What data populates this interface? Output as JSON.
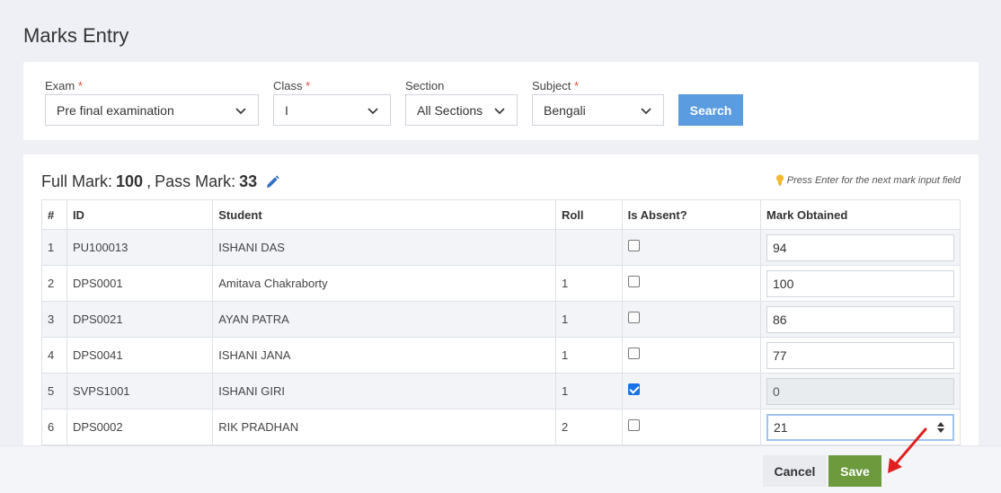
{
  "page": {
    "title": "Marks Entry"
  },
  "filters": {
    "exam": {
      "label": "Exam",
      "value": "Pre final examination"
    },
    "class": {
      "label": "Class",
      "value": "I"
    },
    "section": {
      "label": "Section",
      "value": "All Sections"
    },
    "subject": {
      "label": "Subject",
      "value": "Bengali"
    },
    "required_marker": "*",
    "search_label": "Search"
  },
  "marks": {
    "full_label": "Full Mark:",
    "full_value": "100",
    "pass_label": "Pass Mark:",
    "pass_value": "33",
    "hint": "Press Enter for the next mark input field"
  },
  "table": {
    "headers": [
      "#",
      "ID",
      "Student",
      "Roll",
      "Is Absent?",
      "Mark Obtained"
    ],
    "rows": [
      {
        "num": "1",
        "id": "PU100013",
        "student": "ISHANI DAS",
        "roll": "",
        "absent": false,
        "mark": "94"
      },
      {
        "num": "2",
        "id": "DPS0001",
        "student": "Amitava Chakraborty",
        "roll": "1",
        "absent": false,
        "mark": "100"
      },
      {
        "num": "3",
        "id": "DPS0021",
        "student": "AYAN PATRA",
        "roll": "1",
        "absent": false,
        "mark": "86"
      },
      {
        "num": "4",
        "id": "DPS0041",
        "student": "ISHANI JANA",
        "roll": "1",
        "absent": false,
        "mark": "77"
      },
      {
        "num": "5",
        "id": "SVPS1001",
        "student": "ISHANI GIRI",
        "roll": "1",
        "absent": true,
        "mark": "0"
      },
      {
        "num": "6",
        "id": "DPS0002",
        "student": "RIK PRADHAN",
        "roll": "2",
        "absent": false,
        "mark": "21"
      }
    ]
  },
  "footer": {
    "cancel_label": "Cancel",
    "save_label": "Save"
  },
  "colors": {
    "search": "#5b9be0",
    "save": "#6c9a3c",
    "arrow": "#e02020",
    "checkbox": "#1a73e8"
  }
}
